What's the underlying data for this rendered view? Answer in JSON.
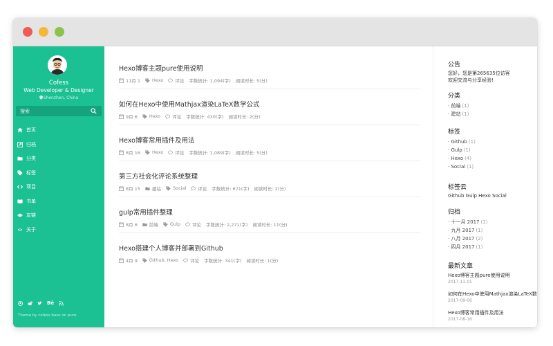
{
  "sidebar": {
    "site_name": "Cofess",
    "site_description": "Web Developer & Designer",
    "location": "Shenzhen, China",
    "search_placeholder": "搜索",
    "nav": [
      {
        "label": "首页",
        "icon": "home-icon"
      },
      {
        "label": "归档",
        "icon": "archive-icon"
      },
      {
        "label": "分类",
        "icon": "folder-icon"
      },
      {
        "label": "标签",
        "icon": "tag-icon"
      },
      {
        "label": "项目",
        "icon": "code-icon"
      },
      {
        "label": "书单",
        "icon": "book-icon"
      },
      {
        "label": "友链",
        "icon": "link-icon"
      },
      {
        "label": "关于",
        "icon": "about-icon"
      }
    ],
    "social": {
      "github": "github-icon",
      "weibo": "weibo-icon",
      "twitter": "twitter-icon",
      "behance_label": "Bē",
      "rss": "rss-icon"
    },
    "footer": "Theme by cofess base on pure."
  },
  "posts": [
    {
      "title": "Hexo博客主题pure使用说明",
      "date": "11月 1",
      "category": "Hexo",
      "comments": "评论",
      "words": "字数统计: 1,094(字)",
      "read_time": "阅读时长: 5(分)"
    },
    {
      "title": "如何在Hexo中使用Mathjax渲染LaTeX数学公式",
      "date": "9月 6",
      "category": "Hexo",
      "comments": "评论",
      "words": "字数统计: 430(字)",
      "read_time": "阅读时长: 2(分)"
    },
    {
      "title": "Hexo博客常用插件及用法",
      "date": "8月 16",
      "category": "Hexo",
      "comments": "评论",
      "words": "字数统计: 1,089(字)",
      "read_time": "阅读时长: 5(分)"
    },
    {
      "title": "第三方社会化评论系统整理",
      "date": "8月 15",
      "category": "建站",
      "tag": "Social",
      "comments": "评论",
      "words": "字数统计: 671(字)",
      "read_time": "阅读时长: 2(分)"
    },
    {
      "title": "gulp常用插件整理",
      "date": "8月 6",
      "category": "前端",
      "tag": "Gulp",
      "comments": "评论",
      "words": "字数统计: 2,271(字)",
      "read_time": "阅读时长: 11(分)"
    },
    {
      "title": "Hexo搭建个人博客并部署到Github",
      "date": "4月 9",
      "tags": "Github, Hexo",
      "comments": "评论",
      "words": "字数统计: 341(字)",
      "read_time": "阅读时长: 1(分)"
    }
  ],
  "right": {
    "notice_title": "公告",
    "notice_line1": "您好，您是第265635位访客",
    "notice_line2": "欢迎交流与分享经验!",
    "categories_title": "分类",
    "categories": [
      {
        "label": "前端",
        "count": "(1)"
      },
      {
        "label": "建站",
        "count": "(1)"
      }
    ],
    "tags_title": "标签",
    "tags": [
      {
        "label": "Github",
        "count": "(1)"
      },
      {
        "label": "Gulp",
        "count": "(1)"
      },
      {
        "label": "Hexo",
        "count": "(4)"
      },
      {
        "label": "Social",
        "count": "(1)"
      }
    ],
    "tagcloud_title": "标签云",
    "tagcloud": "Github Gulp Hexo Social",
    "archive_title": "归档",
    "archives": [
      {
        "label": "十一月 2017",
        "count": "(1)"
      },
      {
        "label": "九月 2017",
        "count": "(1)"
      },
      {
        "label": "八月 2017",
        "count": "(2)"
      },
      {
        "label": "四月 2017",
        "count": "(1)"
      }
    ],
    "recent_title": "最新文章",
    "recent": [
      {
        "title": "Hexo博客主题pure使用说明",
        "date": "2017-11-01"
      },
      {
        "title": "如何在Hexo中使用Mathjax渲染LaTeX数学",
        "date": "2017-09-06"
      },
      {
        "title": "Hexo博客常用插件及用法",
        "date": "2017-08-16"
      }
    ]
  }
}
